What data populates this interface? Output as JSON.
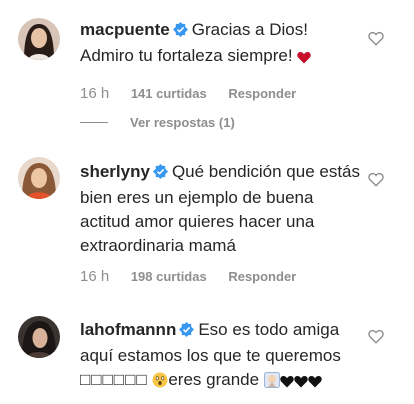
{
  "comments": [
    {
      "username": "macpuente",
      "text_line1": "Gracias a Dios!",
      "text_line2": "Admiro tu fortaleza siempre!",
      "time": "16 h",
      "likes": "141 curtidas",
      "reply": "Responder",
      "view_replies": "Ver respostas (1)"
    },
    {
      "username": "sherlyny",
      "text": "Qué bendición que estás bien eres un ejemplo de buena actitud amor quieres hacer una extraordinaria mamá",
      "time": "16 h",
      "likes": "198 curtidas",
      "reply": "Responder"
    },
    {
      "username": "lahofmannn",
      "text_line1": "Eso es todo amiga",
      "text_line2": "aquí estamos los que te queremos",
      "tofu": "□□□□□□",
      "eres": "eres grande"
    }
  ],
  "colors": {
    "verified": "#3897f0",
    "red_heart": "#c8102e",
    "muted": "#8e8e8e"
  },
  "icons": [
    "verified-badge-icon",
    "heart-outline-icon",
    "red-heart-emoji",
    "astonished-face-emoji",
    "praying-face-emoji",
    "black-heart-emoji"
  ]
}
